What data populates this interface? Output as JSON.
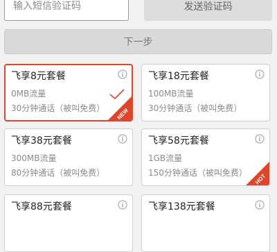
{
  "verify": {
    "sms_placeholder": "输入短信验证码",
    "send_code_label": "发送验证码",
    "next_label": "下一步"
  },
  "plans": [
    {
      "title": "飞享8元套餐",
      "data": "0MB流量",
      "voice": "30分钟通话（被叫免费）",
      "selected": true,
      "badge": "NEW"
    },
    {
      "title": "飞享18元套餐",
      "data": "100MB流量",
      "voice": "30分钟通话（被叫免费）"
    },
    {
      "title": "飞享38元套餐",
      "data": "300MB流量",
      "voice": "80分钟通话（被叫免费）"
    },
    {
      "title": "飞享58元套餐",
      "data": "1GB流量",
      "voice": "150分钟通话（被叫免费）",
      "badge": "HOT"
    },
    {
      "title": "飞享88元套餐"
    },
    {
      "title": "飞享138元套餐"
    }
  ],
  "icons": {
    "info": "info-circle-icon",
    "check": "checkmark-icon"
  },
  "colors": {
    "accent": "#e0452a",
    "background": "#f1f1f1",
    "button_disabled": "#dcdcdc"
  }
}
